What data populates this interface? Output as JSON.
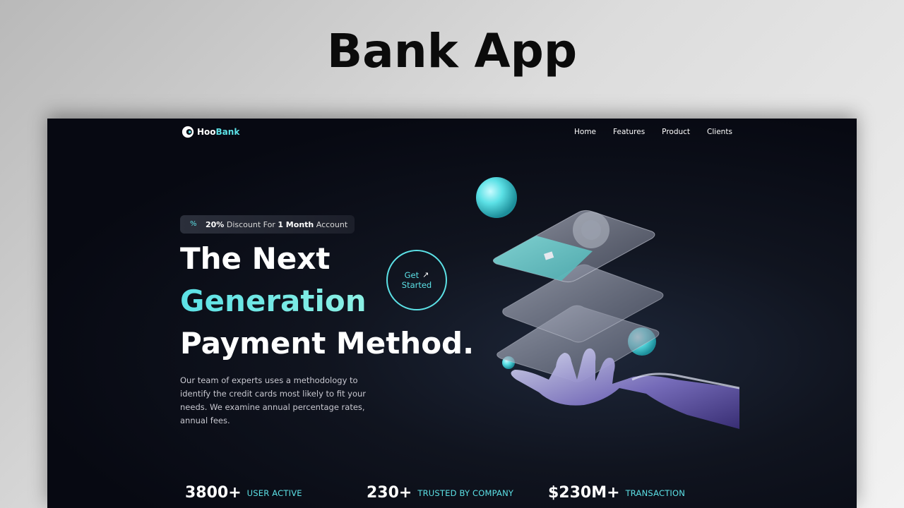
{
  "banner": {
    "title": "Bank App"
  },
  "logo": {
    "prefix": "Hoo",
    "suffix": "Bank"
  },
  "nav": {
    "items": [
      "Home",
      "Features",
      "Product",
      "Clients"
    ]
  },
  "badge": {
    "percent": "20%",
    "text1": "Discount For",
    "highlight": "1 Month",
    "text2": "Account"
  },
  "hero": {
    "line1": "The Next",
    "line2": "Generation",
    "line3": "Payment Method.",
    "description": "Our team of experts uses a methodology to identify the credit cards most likely to fit your needs. We examine annual percentage rates, annual fees."
  },
  "cta": {
    "line1": "Get",
    "line2": "Started"
  },
  "stats": [
    {
      "value": "3800+",
      "label": "USER ACTIVE"
    },
    {
      "value": "230+",
      "label": "TRUSTED BY COMPANY"
    },
    {
      "value": "$230M+",
      "label": "TRANSACTION"
    }
  ],
  "colors": {
    "accent": "#5ce1e6",
    "background": "#0b0e18",
    "text": "#ffffff"
  },
  "icons": {
    "logo": "hoobank-logo-icon",
    "badge": "discount-icon",
    "cta": "arrow-up-right-icon"
  }
}
